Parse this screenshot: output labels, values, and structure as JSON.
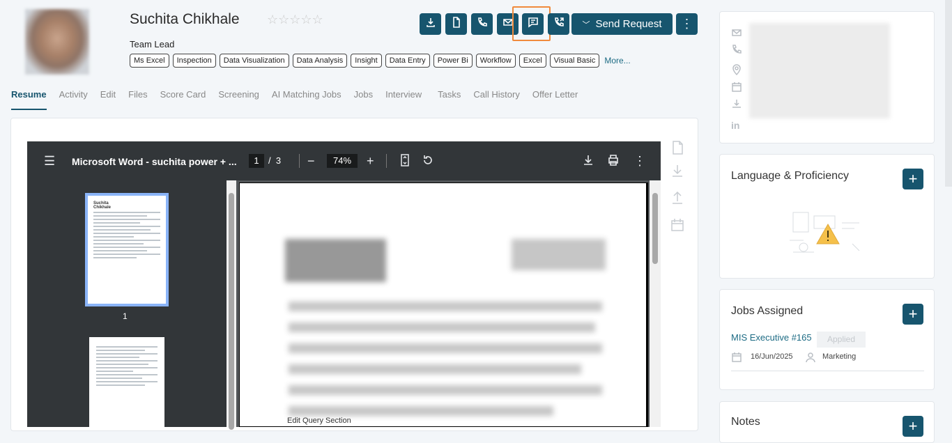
{
  "profile": {
    "name": "Suchita Chikhale",
    "role": "Team Lead",
    "rating_stars": "☆☆☆☆☆",
    "rating_value": 0,
    "skills": [
      "Ms Excel",
      "Inspection",
      "Data Visualization",
      "Data Analysis",
      "Insight",
      "Data Entry",
      "Power Bi",
      "Workflow",
      "Excel",
      "Visual Basic"
    ],
    "more_label": "More..."
  },
  "actions": {
    "icons": [
      "download-icon",
      "document-icon",
      "phone-icon",
      "mail-icon",
      "message-icon",
      "call-forward-icon"
    ],
    "send_request": "Send Request",
    "more_icon": "⋮"
  },
  "tabs": [
    {
      "label": "Resume",
      "active": true
    },
    {
      "label": "Activity"
    },
    {
      "label": "Edit"
    },
    {
      "label": "Files"
    },
    {
      "label": "Score Card"
    },
    {
      "label": "Screening"
    },
    {
      "label": "AI Matching Jobs"
    },
    {
      "label": "Jobs"
    },
    {
      "label": "Interview"
    },
    {
      "label": "Tasks"
    },
    {
      "label": "Call History"
    },
    {
      "label": "Offer Letter"
    }
  ],
  "viewer": {
    "title": "Microsoft Word - suchita power + ...",
    "page": "1",
    "of": "/",
    "total": "3",
    "zoom": "74%",
    "thumb_label": "1",
    "footer_text": "Edit Query Section",
    "thumb_name_line1": "Suchita",
    "thumb_name_line2": "Chikhale"
  },
  "right": {
    "language": {
      "title": "Language & Proficiency",
      "add": "+"
    },
    "jobs": {
      "title": "Jobs Assigned",
      "add": "+",
      "job_title": "MIS Executive #165",
      "status": "Applied",
      "date": "16/Jun/2025",
      "department": "Marketing"
    },
    "notes": {
      "title": "Notes",
      "add": "+"
    }
  },
  "colors": {
    "primary": "#17556e",
    "highlight": "#f08a3c"
  }
}
